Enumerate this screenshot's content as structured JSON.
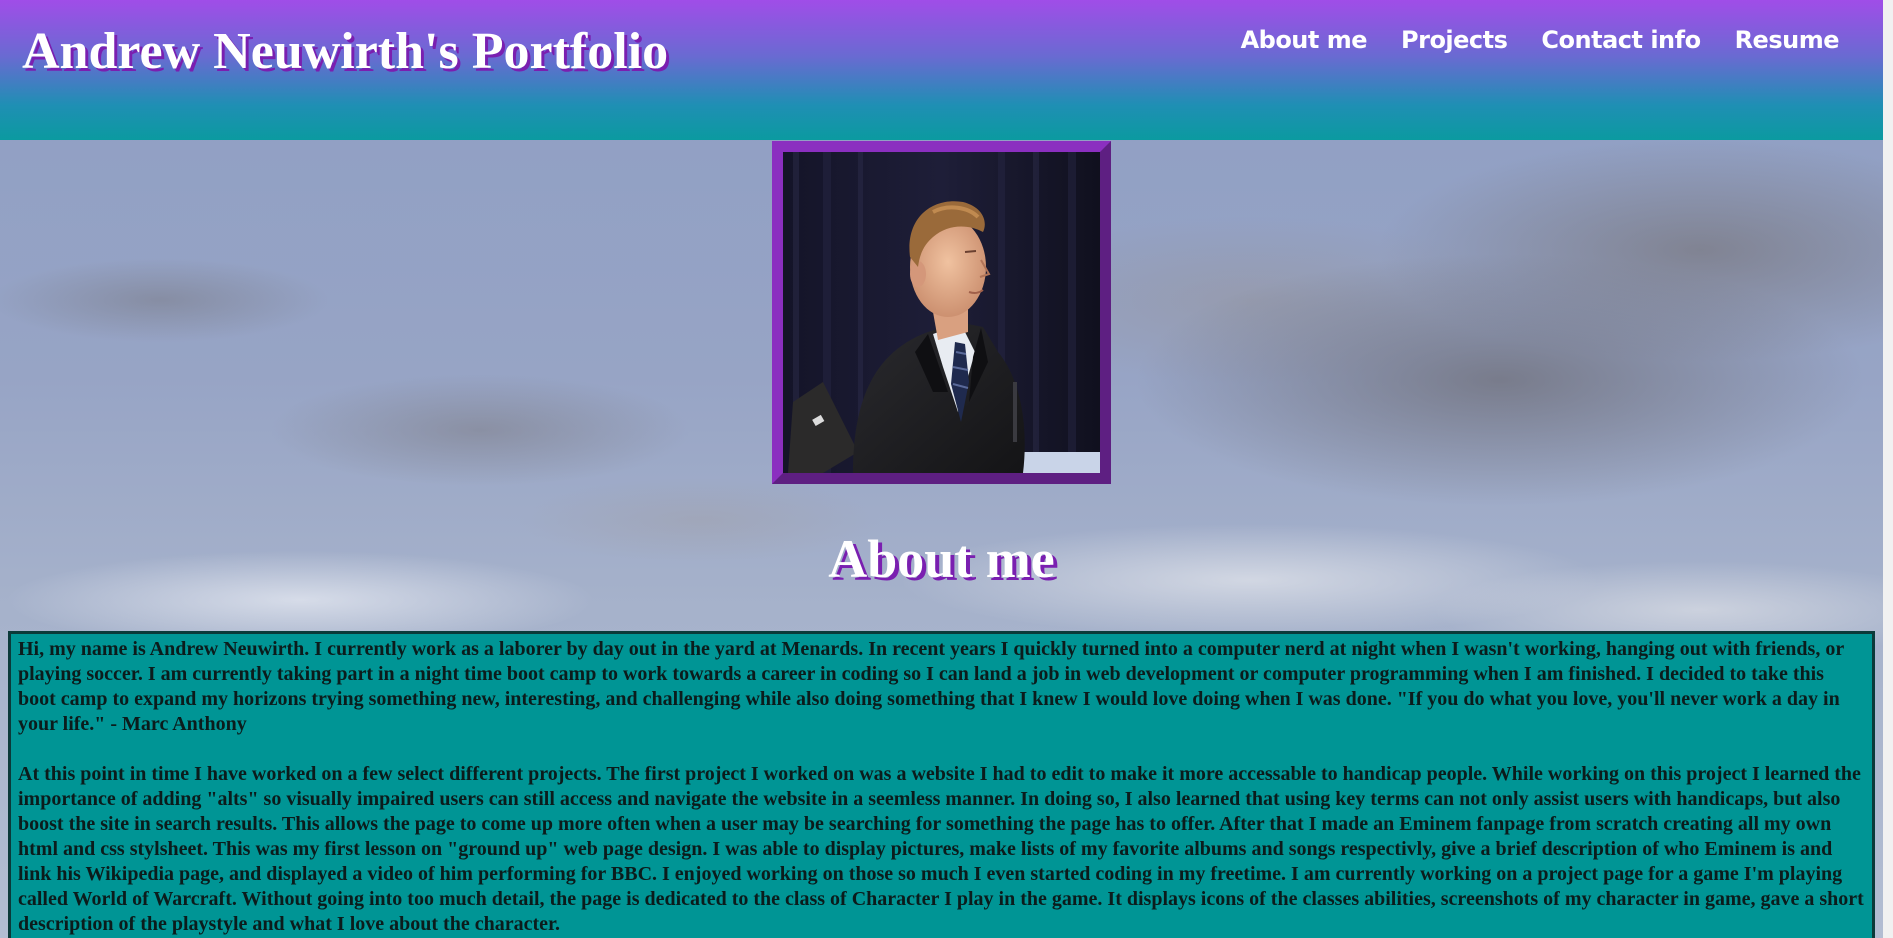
{
  "header": {
    "title": "Andrew Neuwirth's Portfolio",
    "nav": [
      {
        "label": "About me"
      },
      {
        "label": "Projects"
      },
      {
        "label": "Contact info"
      },
      {
        "label": "Resume"
      }
    ]
  },
  "about": {
    "heading": "About me",
    "paragraphs": [
      "Hi, my name is Andrew Neuwirth. I currently work as a laborer by day out in the yard at Menards. In recent years I quickly turned into a computer nerd at night when I wasn't working, hanging out with friends, or playing soccer. I am currently taking part in a night time boot camp to work towards a career in coding so I can land a job in web development or computer programming when I am finished. I decided to take this boot camp to expand my horizons trying something new, interesting, and challenging while also doing something that I knew I would love doing when I was done. \"If you do what you love, you'll never work a day in your life.\" - Marc Anthony",
      "At this point in time I have worked on a few select different projects. The first project I worked on was a website I had to edit to make it more accessable to handicap people. While working on this project I learned the importance of adding \"alts\" so visually impaired users can still access and navigate the website in a seemless manner. In doing so, I also learned that using key terms can not only assist users with handicaps, but also boost the site in search results. This allows the page to come up more often when a user may be searching for something the page has to offer. After that I made an Eminem fanpage from scratch creating all my own html and css stylsheet. This was my first lesson on \"ground up\" web page design. I was able to display pictures, make lists of my favorite albums and songs respectivly, give a brief description of who Eminem is and link his Wikipedia page, and displayed a video of him performing for BBC. I enjoyed working on those so much I even started coding in my freetime. I am currently working on a project page for a game I'm playing called World of Warcraft. Without going into too much detail, the page is dedicated to the class of Character I play in the game. It displays icons of the classes abilities, screenshots of my character in game, gave a short description of the playstyle and what I love about the character."
    ]
  },
  "colors": {
    "header_top": "#a04de8",
    "header_bottom": "#0b9aa0",
    "frame_purple": "#8b2fc0",
    "about_box_bg": "#009595",
    "title_shadow": "#7a1fb0"
  },
  "icons": {
    "portrait": "portrait-photo"
  }
}
